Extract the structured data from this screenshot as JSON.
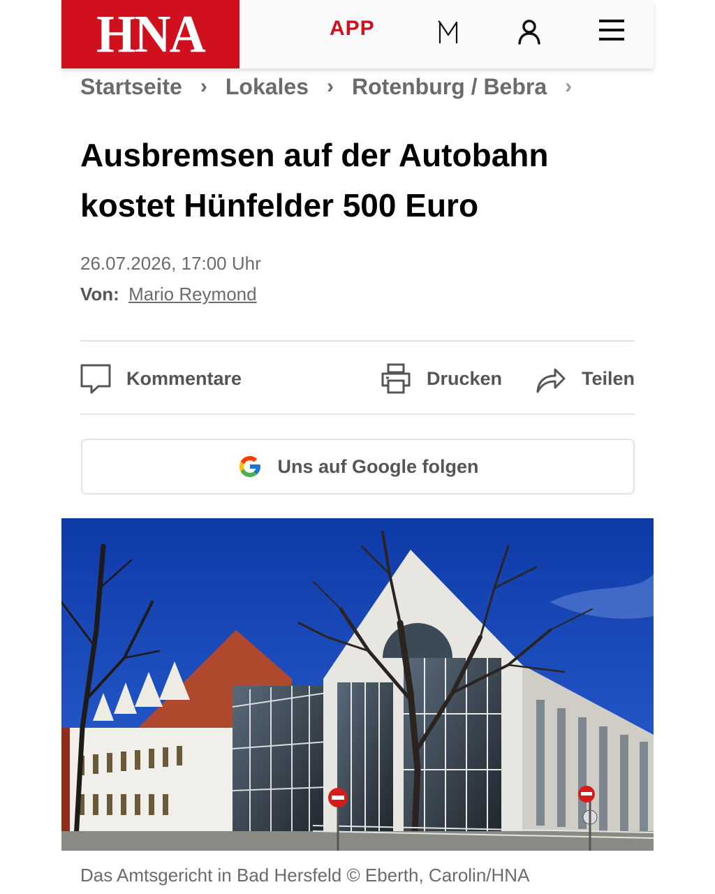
{
  "header": {
    "logo_text": "HNA",
    "app_label": "APP",
    "brand_color": "#d0101c",
    "icons": [
      "m-icon",
      "user-icon",
      "menu-icon"
    ]
  },
  "breadcrumb": {
    "items": [
      "Startseite",
      "Lokales",
      "Rotenburg / Bebra"
    ],
    "separator": "›"
  },
  "article": {
    "headline_line1": "Ausbremsen auf der Autobahn",
    "headline_line2": "kostet Hünfelder 500 Euro",
    "date": "26.07.2026, 17:00 Uhr",
    "byline_label": "Von:",
    "author": "Mario Reymond"
  },
  "actions": {
    "comments_label": "Kommentare",
    "print_label": "Drucken",
    "share_label": "Teilen"
  },
  "google_follow": {
    "label": "Uns auf Google folgen"
  },
  "image": {
    "caption": "Das Amtsgericht in Bad Hersfeld © Eberth, Carolin/HNA"
  }
}
